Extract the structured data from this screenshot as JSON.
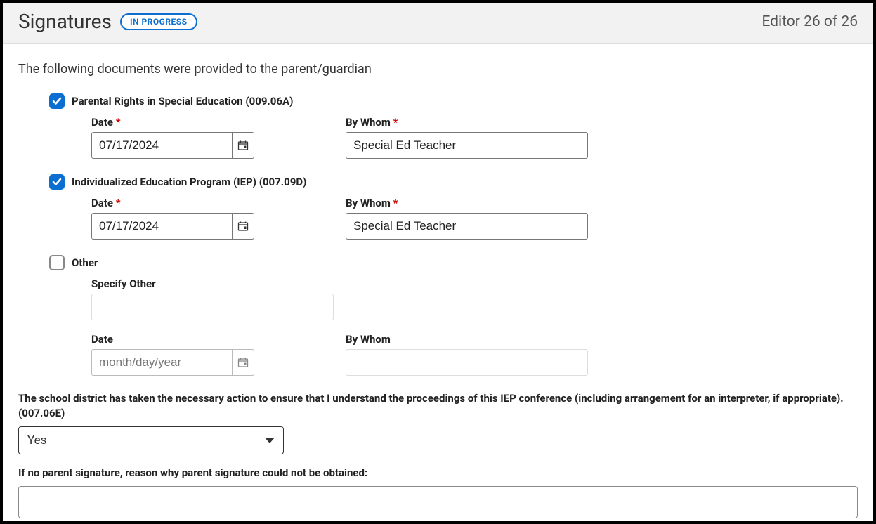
{
  "header": {
    "title": "Signatures",
    "status_badge": "IN PROGRESS",
    "editor_count": "Editor 26 of 26"
  },
  "intro_text": "The following documents were provided to the parent/guardian",
  "labels": {
    "date": "Date",
    "by_whom": "By Whom",
    "specify_other": "Specify Other",
    "date_placeholder": "month/day/year"
  },
  "documents": {
    "parental_rights": {
      "checked": true,
      "label": "Parental Rights in Special Education (009.06A)",
      "date": "07/17/2024",
      "by_whom": "Special Ed Teacher",
      "date_required": true,
      "by_whom_required": true
    },
    "iep": {
      "checked": true,
      "label": "Individualized Education Program (IEP) (007.09D)",
      "date": "07/17/2024",
      "by_whom": "Special Ed Teacher",
      "date_required": true,
      "by_whom_required": true
    },
    "other": {
      "checked": false,
      "label": "Other",
      "specify_other_value": "",
      "date": "",
      "by_whom": ""
    }
  },
  "action_statement": "The school district has taken the necessary action to ensure that I understand the proceedings of this IEP conference (including arrangement for an interpreter, if appropriate). (007.06E)",
  "action_select_value": "Yes",
  "no_sig_label": "If no parent signature, reason why parent signature could not be obtained:",
  "no_sig_value": ""
}
